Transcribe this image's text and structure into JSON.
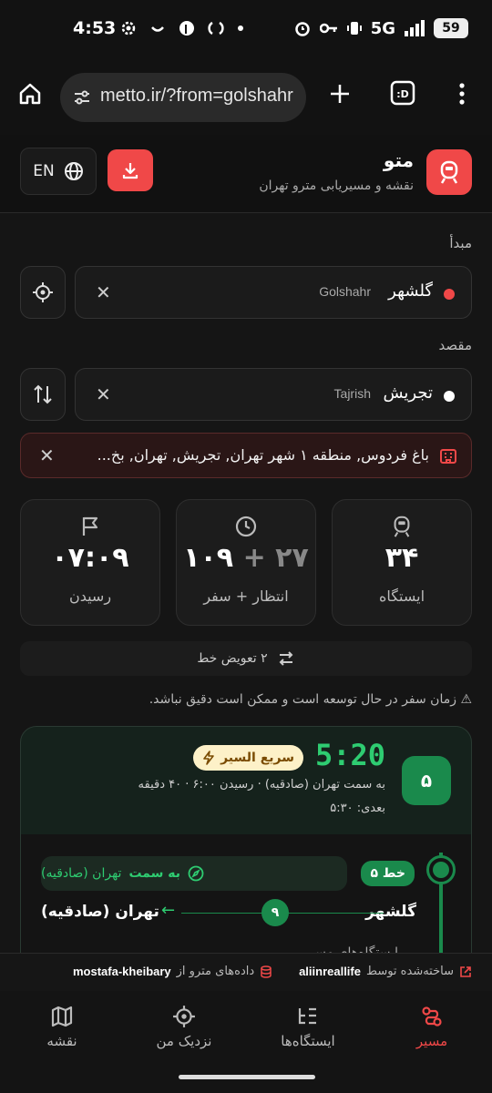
{
  "status_bar": {
    "time": "4:53",
    "network": "5G",
    "battery": "59"
  },
  "browser": {
    "url": "metto.ir/?from=golshahr"
  },
  "app": {
    "title": "متو",
    "subtitle": "نقشه و مسیریابی مترو تهران",
    "lang_label": "EN"
  },
  "origin": {
    "label": "مبدأ",
    "name_fa": "گلشهر",
    "name_en": "Golshahr",
    "dot_color": "#f04848"
  },
  "destination": {
    "label": "مقصد",
    "name_fa": "تجریش",
    "name_en": "Tajrish",
    "dot_color": "#ffffff"
  },
  "address": "باغ فردوس, منطقه ۱ شهر تهران, تجریش, تهران, بخ...",
  "stats": {
    "stations": {
      "value": "۳۴",
      "label": "ایستگاه"
    },
    "time": {
      "ride": "۱۰۹",
      "plus": "+",
      "wait": "۲۷",
      "label": "انتظار + سفر"
    },
    "arrival": {
      "value": "۰۷:۰۹",
      "label": "رسیدن"
    }
  },
  "transfers": "۲ تعویض خط",
  "warning": "⚠ زمان سفر در حال توسعه است و ممکن است دقیق نباشد.",
  "trip": {
    "line_number": "۵",
    "departure": "5:20",
    "express": "سریع السیر",
    "meta": "به سمت تهران (صادقیه) · رسیدن ۶:۰۰ · ۴۰ دقیقه",
    "next": "بعدی: ۵:۳۰",
    "line_chip": "خط ۵",
    "direction_prefix": "به سمت",
    "direction_name": "تهران (صادقیه)",
    "origin_station": "گلشهر",
    "dest_station": "تهران (صادقیه)",
    "stop_count": "۹",
    "stations_toggle": "ایستگاه‌های مسیر"
  },
  "credits": {
    "built_by_prefix": "ساخته‌شده توسط",
    "built_by": "aliinreallife",
    "data_prefix": "داده‌های مترو از",
    "data_by": "mostafa-kheibary"
  },
  "nav": {
    "route": "مسیر",
    "stations": "ایستگاه‌ها",
    "nearby": "نزدیک من",
    "map": "نقشه"
  },
  "colors": {
    "accent_red": "#f04848",
    "line5_green": "#1a8a4c",
    "time_green": "#2ecc71"
  }
}
